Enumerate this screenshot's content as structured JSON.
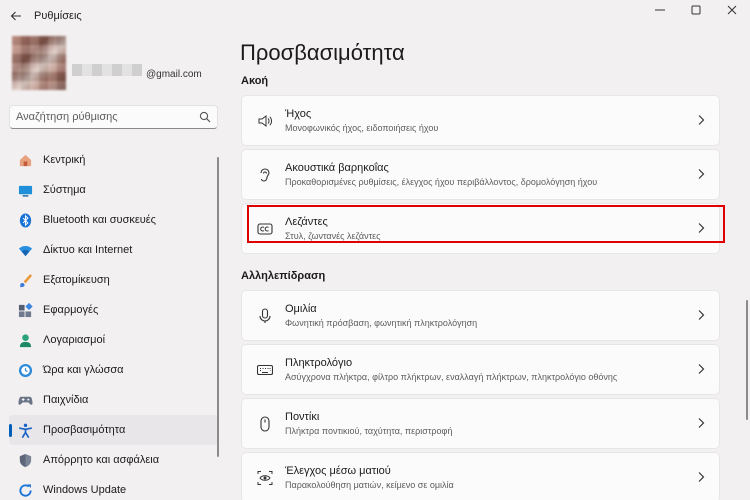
{
  "app": {
    "title": "Ρυθμίσεις"
  },
  "profile": {
    "email": "@gmail.com"
  },
  "search": {
    "placeholder": "Αναζήτηση ρύθμισης"
  },
  "sidebar": {
    "items": [
      {
        "label": "Κεντρική",
        "icon": "home-icon"
      },
      {
        "label": "Σύστημα",
        "icon": "system-icon"
      },
      {
        "label": "Bluetooth και συσκευές",
        "icon": "bluetooth-icon"
      },
      {
        "label": "Δίκτυο και Internet",
        "icon": "wifi-icon"
      },
      {
        "label": "Εξατομίκευση",
        "icon": "brush-icon"
      },
      {
        "label": "Εφαρμογές",
        "icon": "apps-icon"
      },
      {
        "label": "Λογαριασμοί",
        "icon": "account-icon"
      },
      {
        "label": "Ώρα και γλώσσα",
        "icon": "time-language-icon"
      },
      {
        "label": "Παιχνίδια",
        "icon": "gaming-icon"
      },
      {
        "label": "Προσβασιμότητα",
        "icon": "accessibility-icon"
      },
      {
        "label": "Απόρρητο και ασφάλεια",
        "icon": "shield-icon"
      },
      {
        "label": "Windows Update",
        "icon": "update-icon"
      }
    ]
  },
  "main": {
    "title": "Προσβασιμότητα",
    "sections": {
      "hearing": "Ακοή",
      "interaction": "Αλληλεπίδραση"
    },
    "cards": [
      {
        "title": "Ήχος",
        "subtitle": "Μονοφωνικός ήχος, ειδοποιήσεις ήχου",
        "icon": "speaker-icon"
      },
      {
        "title": "Ακουστικά βαρηκοΐας",
        "subtitle": "Προκαθορισμένες ρυθμίσεις, έλεγχος ήχου περιβάλλοντος, δρομολόγηση ήχου",
        "icon": "hearing-aid-icon"
      },
      {
        "title": "Λεζάντες",
        "subtitle": "Στυλ, ζωντανές λεζάντες",
        "icon": "captions-icon"
      },
      {
        "title": "Ομιλία",
        "subtitle": "Φωνητική πρόσβαση, φωνητική πληκτρολόγηση",
        "icon": "microphone-icon"
      },
      {
        "title": "Πληκτρολόγιο",
        "subtitle": "Ασύγχρονα πλήκτρα, φίλτρο πλήκτρων, εναλλαγή πλήκτρων, πληκτρολόγιο οθόνης",
        "icon": "keyboard-icon"
      },
      {
        "title": "Ποντίκι",
        "subtitle": "Πλήκτρα ποντικιού, ταχύτητα, περιστροφή",
        "icon": "mouse-icon"
      },
      {
        "title": "Έλεγχος μέσω ματιού",
        "subtitle": "Παρακολούθηση ματιών, κείμενο σε ομιλία",
        "icon": "eye-control-icon"
      }
    ]
  },
  "colors": {
    "accent": "#005fb8",
    "highlight": "#e00000"
  }
}
